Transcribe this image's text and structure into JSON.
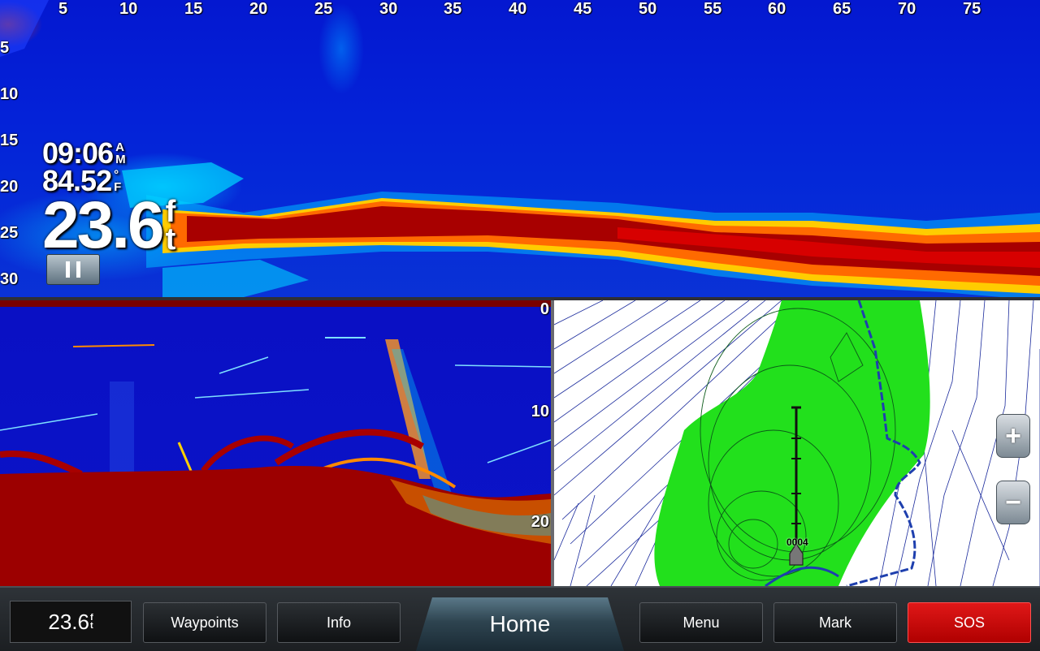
{
  "top_sonar": {
    "x_ticks": [
      "5",
      "10",
      "15",
      "20",
      "25",
      "30",
      "35",
      "40",
      "45",
      "50",
      "55",
      "60",
      "65",
      "70",
      "75"
    ],
    "y_ticks": [
      "5",
      "10",
      "15",
      "20",
      "25",
      "30"
    ]
  },
  "readouts": {
    "time": "09:06",
    "time_unit_top": "A",
    "time_unit_bottom": "M",
    "temperature": "84.52",
    "temp_unit_top": "°",
    "temp_unit_bottom": "F",
    "depth": "23.6",
    "depth_unit_top": "f",
    "depth_unit_bottom": "t"
  },
  "down_sonar": {
    "depth_ticks": [
      "0",
      "10",
      "20"
    ]
  },
  "map": {
    "waypoint_label": "0004",
    "zoom_in_label": "+",
    "zoom_out_label": "−",
    "colors": {
      "shallow": "#22e01c",
      "contour": "#1a2a9c",
      "track": "#1e3fae"
    }
  },
  "toolbar": {
    "depth_value": "23.6",
    "depth_unit_top": "f",
    "depth_unit_bottom": "t",
    "waypoints_label": "Waypoints",
    "info_label": "Info",
    "home_label": "Home",
    "menu_label": "Menu",
    "mark_label": "Mark",
    "sos_label": "SOS"
  }
}
